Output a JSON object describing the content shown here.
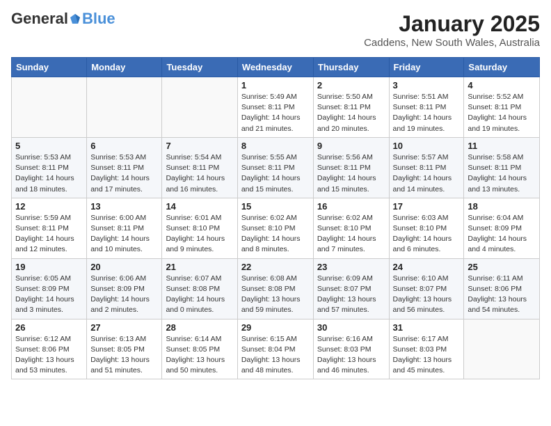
{
  "header": {
    "logo_general": "General",
    "logo_blue": "Blue",
    "month_title": "January 2025",
    "location": "Caddens, New South Wales, Australia"
  },
  "days_of_week": [
    "Sunday",
    "Monday",
    "Tuesday",
    "Wednesday",
    "Thursday",
    "Friday",
    "Saturday"
  ],
  "weeks": [
    [
      {
        "day": null,
        "info": null
      },
      {
        "day": null,
        "info": null
      },
      {
        "day": null,
        "info": null
      },
      {
        "day": "1",
        "info": "Sunrise: 5:49 AM\nSunset: 8:11 PM\nDaylight: 14 hours\nand 21 minutes."
      },
      {
        "day": "2",
        "info": "Sunrise: 5:50 AM\nSunset: 8:11 PM\nDaylight: 14 hours\nand 20 minutes."
      },
      {
        "day": "3",
        "info": "Sunrise: 5:51 AM\nSunset: 8:11 PM\nDaylight: 14 hours\nand 19 minutes."
      },
      {
        "day": "4",
        "info": "Sunrise: 5:52 AM\nSunset: 8:11 PM\nDaylight: 14 hours\nand 19 minutes."
      }
    ],
    [
      {
        "day": "5",
        "info": "Sunrise: 5:53 AM\nSunset: 8:11 PM\nDaylight: 14 hours\nand 18 minutes."
      },
      {
        "day": "6",
        "info": "Sunrise: 5:53 AM\nSunset: 8:11 PM\nDaylight: 14 hours\nand 17 minutes."
      },
      {
        "day": "7",
        "info": "Sunrise: 5:54 AM\nSunset: 8:11 PM\nDaylight: 14 hours\nand 16 minutes."
      },
      {
        "day": "8",
        "info": "Sunrise: 5:55 AM\nSunset: 8:11 PM\nDaylight: 14 hours\nand 15 minutes."
      },
      {
        "day": "9",
        "info": "Sunrise: 5:56 AM\nSunset: 8:11 PM\nDaylight: 14 hours\nand 15 minutes."
      },
      {
        "day": "10",
        "info": "Sunrise: 5:57 AM\nSunset: 8:11 PM\nDaylight: 14 hours\nand 14 minutes."
      },
      {
        "day": "11",
        "info": "Sunrise: 5:58 AM\nSunset: 8:11 PM\nDaylight: 14 hours\nand 13 minutes."
      }
    ],
    [
      {
        "day": "12",
        "info": "Sunrise: 5:59 AM\nSunset: 8:11 PM\nDaylight: 14 hours\nand 12 minutes."
      },
      {
        "day": "13",
        "info": "Sunrise: 6:00 AM\nSunset: 8:11 PM\nDaylight: 14 hours\nand 10 minutes."
      },
      {
        "day": "14",
        "info": "Sunrise: 6:01 AM\nSunset: 8:10 PM\nDaylight: 14 hours\nand 9 minutes."
      },
      {
        "day": "15",
        "info": "Sunrise: 6:02 AM\nSunset: 8:10 PM\nDaylight: 14 hours\nand 8 minutes."
      },
      {
        "day": "16",
        "info": "Sunrise: 6:02 AM\nSunset: 8:10 PM\nDaylight: 14 hours\nand 7 minutes."
      },
      {
        "day": "17",
        "info": "Sunrise: 6:03 AM\nSunset: 8:10 PM\nDaylight: 14 hours\nand 6 minutes."
      },
      {
        "day": "18",
        "info": "Sunrise: 6:04 AM\nSunset: 8:09 PM\nDaylight: 14 hours\nand 4 minutes."
      }
    ],
    [
      {
        "day": "19",
        "info": "Sunrise: 6:05 AM\nSunset: 8:09 PM\nDaylight: 14 hours\nand 3 minutes."
      },
      {
        "day": "20",
        "info": "Sunrise: 6:06 AM\nSunset: 8:09 PM\nDaylight: 14 hours\nand 2 minutes."
      },
      {
        "day": "21",
        "info": "Sunrise: 6:07 AM\nSunset: 8:08 PM\nDaylight: 14 hours\nand 0 minutes."
      },
      {
        "day": "22",
        "info": "Sunrise: 6:08 AM\nSunset: 8:08 PM\nDaylight: 13 hours\nand 59 minutes."
      },
      {
        "day": "23",
        "info": "Sunrise: 6:09 AM\nSunset: 8:07 PM\nDaylight: 13 hours\nand 57 minutes."
      },
      {
        "day": "24",
        "info": "Sunrise: 6:10 AM\nSunset: 8:07 PM\nDaylight: 13 hours\nand 56 minutes."
      },
      {
        "day": "25",
        "info": "Sunrise: 6:11 AM\nSunset: 8:06 PM\nDaylight: 13 hours\nand 54 minutes."
      }
    ],
    [
      {
        "day": "26",
        "info": "Sunrise: 6:12 AM\nSunset: 8:06 PM\nDaylight: 13 hours\nand 53 minutes."
      },
      {
        "day": "27",
        "info": "Sunrise: 6:13 AM\nSunset: 8:05 PM\nDaylight: 13 hours\nand 51 minutes."
      },
      {
        "day": "28",
        "info": "Sunrise: 6:14 AM\nSunset: 8:05 PM\nDaylight: 13 hours\nand 50 minutes."
      },
      {
        "day": "29",
        "info": "Sunrise: 6:15 AM\nSunset: 8:04 PM\nDaylight: 13 hours\nand 48 minutes."
      },
      {
        "day": "30",
        "info": "Sunrise: 6:16 AM\nSunset: 8:03 PM\nDaylight: 13 hours\nand 46 minutes."
      },
      {
        "day": "31",
        "info": "Sunrise: 6:17 AM\nSunset: 8:03 PM\nDaylight: 13 hours\nand 45 minutes."
      },
      {
        "day": null,
        "info": null
      }
    ]
  ]
}
